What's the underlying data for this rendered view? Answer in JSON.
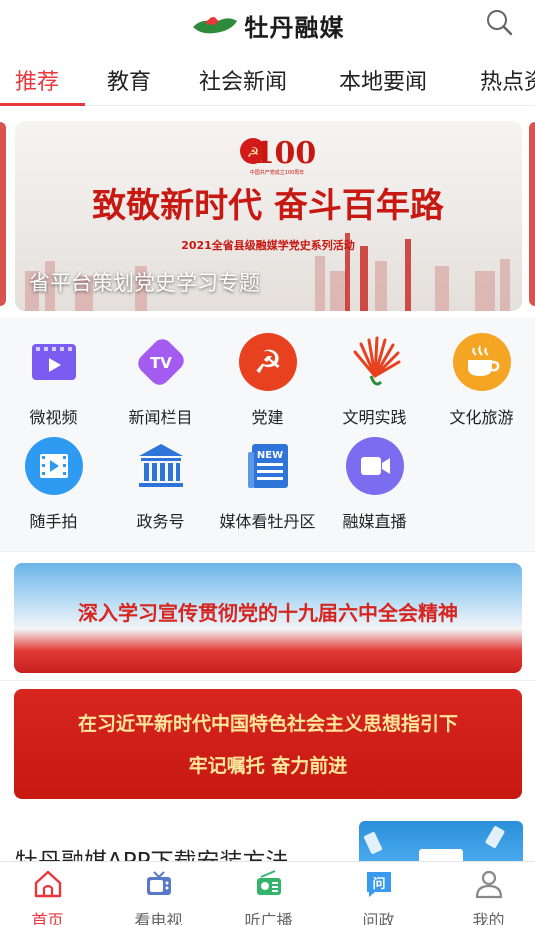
{
  "header": {
    "logo_text": "牡丹融媒",
    "search_icon": "search-icon"
  },
  "tabs": [
    {
      "label": "推荐",
      "active": true
    },
    {
      "label": "教育"
    },
    {
      "label": "社会新闻"
    },
    {
      "label": "本地要闻"
    },
    {
      "label": "热点资讯"
    }
  ],
  "hero": {
    "badge_number": "100",
    "slogan": "致敬新时代  奋斗百年路",
    "subtitle": "2021全省县级融媒学党史系列活动",
    "caption": "省平台策划党史学习专题"
  },
  "grid": [
    {
      "label": "微视频",
      "icon": "video-icon",
      "color": "#7b5cf0"
    },
    {
      "label": "新闻栏目",
      "icon": "tv-icon",
      "color": "#a45cf0"
    },
    {
      "label": "党建",
      "icon": "party-emblem-icon",
      "color": "#e8411f"
    },
    {
      "label": "文明实践",
      "icon": "fan-icon",
      "color": "#e8411f"
    },
    {
      "label": "文化旅游",
      "icon": "coffee-cup-icon",
      "color": "#f5a524"
    },
    {
      "label": "随手拍",
      "icon": "film-icon",
      "color": "#2f9af2"
    },
    {
      "label": "政务号",
      "icon": "government-building-icon",
      "color": "#2f74d8"
    },
    {
      "label": "媒体看牡丹区",
      "icon": "newspaper-icon",
      "color": "#2f74d8"
    },
    {
      "label": "融媒直播",
      "icon": "live-camera-icon",
      "color": "#7b6cf0"
    }
  ],
  "banners": [
    {
      "text": "深入学习宣传贯彻党的十九届六中全会精神"
    },
    {
      "line1": "在习近平新时代中国特色社会主义思想指引下",
      "line2": "牢记嘱托 奋力前进"
    }
  ],
  "article": {
    "title": "牡丹融媒APP下载安装方法"
  },
  "bottom_nav": [
    {
      "label": "首页",
      "icon": "home-icon",
      "active": true
    },
    {
      "label": "看电视",
      "icon": "tv-icon"
    },
    {
      "label": "听广播",
      "icon": "radio-icon"
    },
    {
      "label": "问政",
      "icon": "question-icon"
    },
    {
      "label": "我的",
      "icon": "user-icon"
    }
  ],
  "colors": {
    "accent": "#e8383d",
    "banner_red": "#d7251f",
    "banner_gold": "#fde79b"
  }
}
